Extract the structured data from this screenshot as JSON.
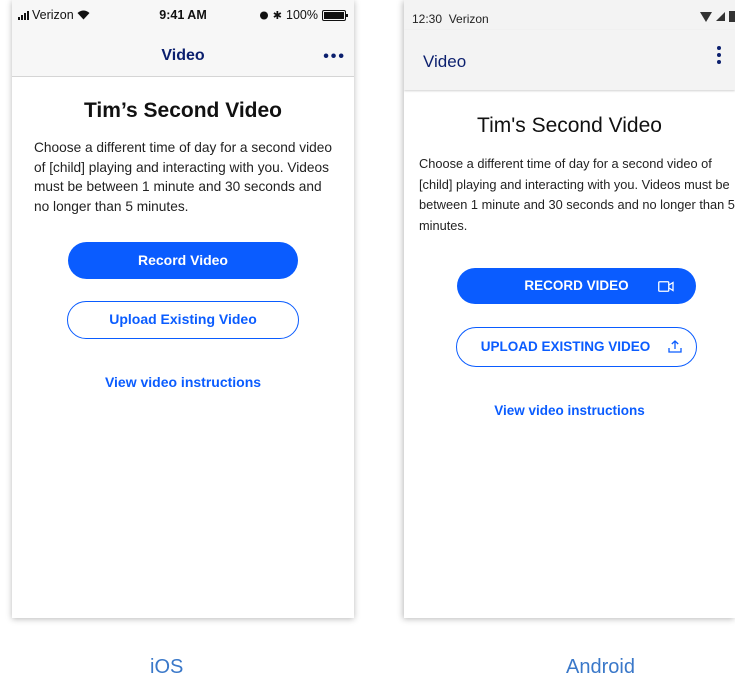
{
  "ios": {
    "status": {
      "carrier": "Verizon",
      "time": "9:41 AM",
      "battery": "100%"
    },
    "nav": {
      "title": "Video",
      "more": "•••"
    },
    "heading": "Tim’s Second Video",
    "description": "Choose a different time of day for a second video of [child] playing and interacting with you. Videos must be between 1 minute and 30 seconds and no longer than 5 minutes.",
    "record_label": "Record Video",
    "upload_label": "Upload Existing Video",
    "instructions_link": "View video instructions",
    "caption": "iOS"
  },
  "android": {
    "status": {
      "time": "12:30",
      "carrier": "Verizon"
    },
    "appbar": {
      "title": "Video"
    },
    "heading": "Tim's Second Video",
    "description": "Choose a different time of day for a second video of [child] playing and interacting with you. Videos must be between 1 minute and 30 seconds and no longer than 5 minutes.",
    "record_label": "RECORD VIDEO",
    "upload_label": "UPLOAD EXISTING VIDEO",
    "instructions_link": "View video instructions",
    "caption": "Android"
  },
  "colors": {
    "accent": "#0a5cff",
    "nav_title": "#0b1f6e",
    "caption": "#3a78c9"
  },
  "icons": [
    "wifi-icon",
    "alarm-icon",
    "bluetooth-icon",
    "battery-icon",
    "more-icon",
    "video-camera-icon",
    "upload-icon",
    "signal-icon"
  ]
}
